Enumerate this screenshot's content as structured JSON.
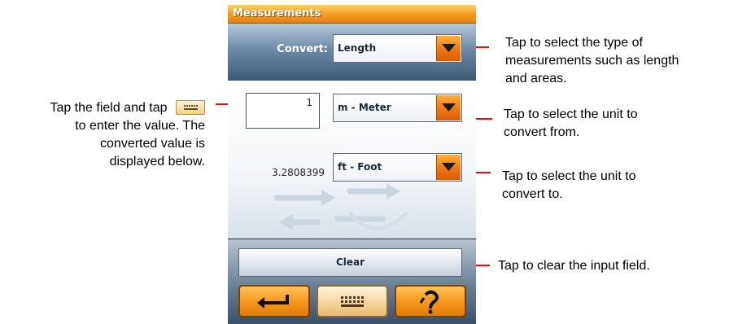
{
  "annotations": {
    "left": [
      "Tap the field and tap",
      "to enter the value. The",
      "converted value is",
      "displayed below."
    ],
    "right_type": [
      "Tap to select the type of",
      "measurements such as length",
      "and areas."
    ],
    "right_from": [
      "Tap to select the unit to",
      "convert from."
    ],
    "right_to": [
      "Tap to select the unit to",
      "convert to."
    ],
    "right_clear": "Tap to clear the input field."
  },
  "app": {
    "title": "Measurements",
    "convert_label": "Convert:",
    "type_select": "Length",
    "input_value": "1",
    "from_unit": "m - Meter",
    "converted_value": "3.2808399",
    "to_unit": "ft - Foot",
    "clear_label": "Clear"
  },
  "icons": {
    "dropdown": "triangle-down-icon",
    "back": "return-arrow-icon",
    "keyboard": "keyboard-icon",
    "help": "question-mark-icon",
    "inline_keyboard": "keyboard-icon"
  },
  "colors": {
    "accent_orange": "#f59a1f",
    "callout_line": "#e0120f",
    "title_bar": "#f39a1e",
    "panel_blue": "#3d5875"
  }
}
